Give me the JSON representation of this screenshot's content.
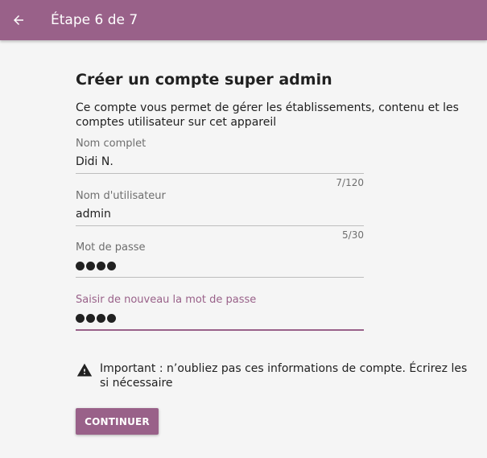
{
  "appbar": {
    "back_icon": "arrow-left-icon",
    "title": "Étape 6 de 7"
  },
  "form": {
    "title": "Créer un compte super admin",
    "description": "Ce compte vous permet de gérer les établissements, contenu et les comptes utilisateur sur cet appareil",
    "fields": {
      "full_name": {
        "label": "Nom complet",
        "value": "Didi N.",
        "counter": "7/120"
      },
      "username": {
        "label": "Nom d'utilisateur",
        "value": "admin",
        "counter": "5/30"
      },
      "password": {
        "label": "Mot de passe",
        "masked_length": 4
      },
      "password_confirm": {
        "label": "Saisir de nouveau la mot de passe",
        "masked_length": 4,
        "focused": true
      }
    },
    "warning": {
      "icon": "warning-triangle-icon",
      "text": "Important : n’oubliez pas ces informations de compte. Écrirez les si nécessaire"
    },
    "continue_label": "CONTINUER"
  },
  "colors": {
    "accent": "#996189",
    "background": "#f5f5f5"
  }
}
